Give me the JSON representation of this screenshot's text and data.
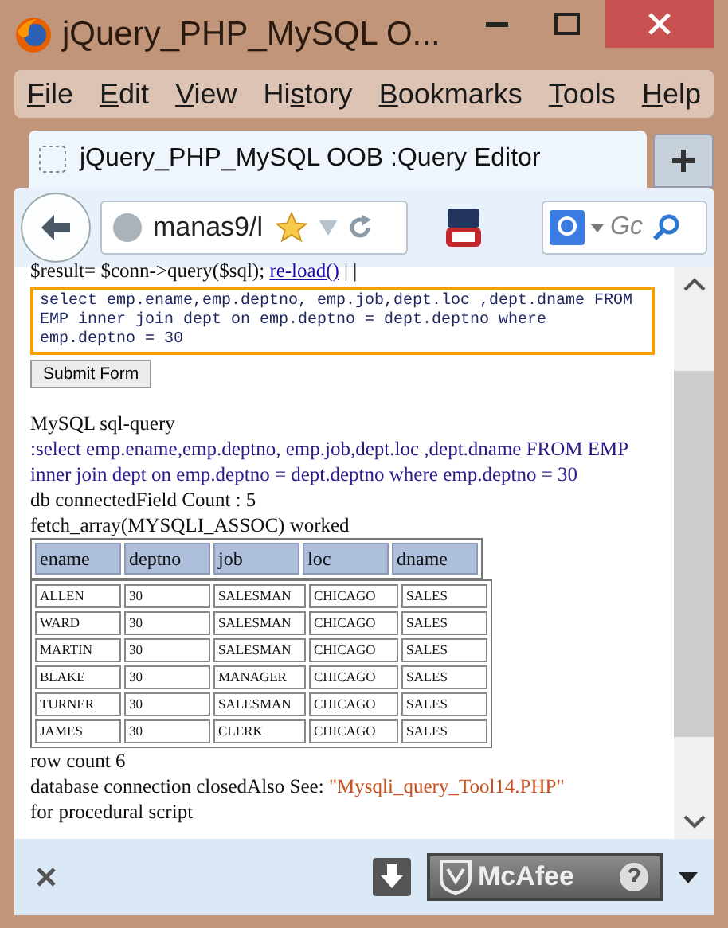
{
  "window": {
    "title": "jQuery_PHP_MySQL O..."
  },
  "menu": [
    {
      "key": "F",
      "after": "ile"
    },
    {
      "key": "E",
      "after": "dit"
    },
    {
      "key": "V",
      "after": "iew"
    },
    {
      "before": "Hi",
      "key": "s",
      "after": "tory"
    },
    {
      "key": "B",
      "after": "ookmarks"
    },
    {
      "key": "T",
      "after": "ools"
    },
    {
      "key": "H",
      "after": "elp"
    }
  ],
  "tabs": [
    {
      "label": "jQuery_PHP_MySQL OOB :Query Editor",
      "selected": true
    }
  ],
  "nav": {
    "url": "manas9/l",
    "search_placeholder": "Gc"
  },
  "page": {
    "code_line": {
      "text": "$result= $conn->query($sql);",
      "link": "re-load()",
      "after": "| |"
    },
    "query": "select emp.ename,emp.deptno, emp.job,dept.loc ,dept.dname FROM EMP inner join dept on emp.deptno = dept.deptno where emp.deptno = 30",
    "submit": "Submit Form",
    "heading": "MySQL sql-query",
    "echo": ":select emp.ename,emp.deptno, emp.job,dept.loc ,dept.dname FROM EMP inner join dept on emp.deptno = dept.deptno where emp.deptno = 30",
    "status_lines": [
      "db connectedField Count : 5",
      "fetch_array(MYSQLI_ASSOC) worked"
    ],
    "table": {
      "columns": [
        "ename",
        "deptno",
        "job",
        "loc",
        "dname"
      ],
      "rows": [
        [
          "ALLEN",
          "30",
          "SALESMAN",
          "CHICAGO",
          "SALES"
        ],
        [
          "WARD",
          "30",
          "SALESMAN",
          "CHICAGO",
          "SALES"
        ],
        [
          "MARTIN",
          "30",
          "SALESMAN",
          "CHICAGO",
          "SALES"
        ],
        [
          "BLAKE",
          "30",
          "MANAGER",
          "CHICAGO",
          "SALES"
        ],
        [
          "TURNER",
          "30",
          "SALESMAN",
          "CHICAGO",
          "SALES"
        ],
        [
          "JAMES",
          "30",
          "CLERK",
          "CHICAGO",
          "SALES"
        ]
      ]
    },
    "row_count": "row count 6",
    "closed": "database connection closedAlso See: ",
    "see_link": "\"Mysqli_query_Tool14.PHP\"",
    "footer": "for procedural script"
  },
  "addon_bar": {
    "addon": "McAfee"
  }
}
